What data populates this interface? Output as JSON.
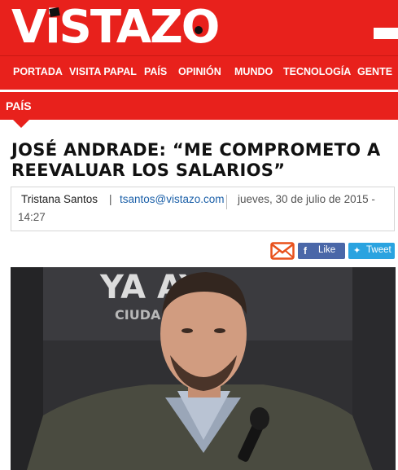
{
  "brand": {
    "logo": "VISTAZO"
  },
  "nav": {
    "items": [
      {
        "label": "PORTADA"
      },
      {
        "label": "VISITA PAPAL"
      },
      {
        "label": "PAÍS"
      },
      {
        "label": "OPINIÓN"
      },
      {
        "label": "MUNDO"
      },
      {
        "label": "TECNOLOGÍA"
      },
      {
        "label": "GENTE"
      }
    ]
  },
  "section": {
    "label": "PAÍS"
  },
  "article": {
    "title": "JOSÉ ANDRADE: “ME COMPROMETO A REEVALUAR LOS SALARIOS”",
    "author": "Tristana Santos",
    "separator": "|",
    "email": "tsantos@vistazo.com",
    "date": "jueves, 30 de julio de 2015 -",
    "time": "14:27"
  },
  "share": {
    "facebook_label": "Like",
    "twitter_label": "Tweet",
    "icons": [
      "mail-icon",
      "facebook-icon",
      "twitter-icon"
    ]
  },
  "photo": {
    "banner_text_top": "YA  AY",
    "banner_text_bottom": "CIUDA       IENTO"
  },
  "colors": {
    "brand_red": "#e8211c",
    "facebook": "#4a67a8",
    "twitter": "#2aa3e0",
    "link": "#1a5fa8"
  }
}
